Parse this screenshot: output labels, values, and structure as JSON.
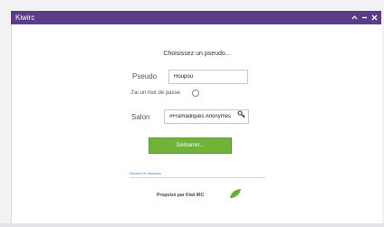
{
  "window": {
    "title": "Kiwirc",
    "controls": {
      "minimize_icon": "chevron-up-icon",
      "restore_icon": "minus-icon",
      "close_icon": "close-icon"
    }
  },
  "form": {
    "heading": "Choisissez un pseudo...",
    "nick_label": "Pseudo",
    "nick_value": "Houpou",
    "password_label": "J'ai un mot de passe",
    "password_checked": false,
    "channel_label": "Salon",
    "channel_value": "#Framadiques Anonymes",
    "channel_key_icon": "key-icon",
    "submit_label": "Démarrer...",
    "server_link": "Serveur et réseau ▸"
  },
  "footer": {
    "powered_by": "Propulsé par Kiwi IRC",
    "logo_icon": "leaf-icon"
  },
  "colors": {
    "titlebar": "#5b3c88",
    "submit": "#71b33a",
    "link": "#4a74b5"
  }
}
